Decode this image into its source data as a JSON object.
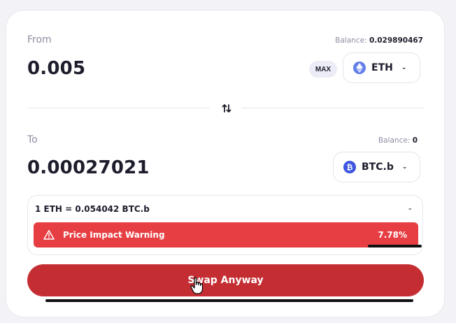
{
  "from": {
    "label": "From",
    "balance_label": "Balance:",
    "balance_value": "0.029890467",
    "amount": "0.005",
    "max_label": "MAX",
    "token": {
      "symbol": "ETH",
      "icon": "eth-icon",
      "color": "#627eea"
    }
  },
  "to": {
    "label": "To",
    "balance_label": "Balance:",
    "balance_value": "0",
    "amount": "0.00027021",
    "token": {
      "symbol": "BTC.b",
      "icon": "btcb-icon",
      "color": "#3d55e0"
    }
  },
  "rate": {
    "text": "1 ETH = 0.054042 BTC.b"
  },
  "warning": {
    "label": "Price Impact Warning",
    "value": "7.78%",
    "color": "#e63e43"
  },
  "action": {
    "swap_label": "Swap Anyway",
    "color": "#c42e33"
  }
}
